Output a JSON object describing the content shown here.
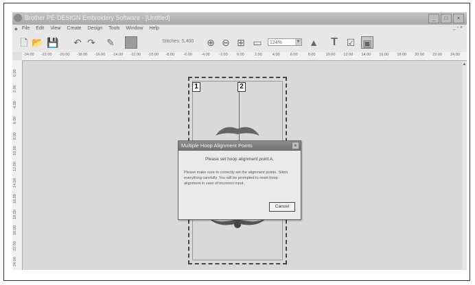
{
  "window": {
    "title": "Brother PE-DESIGN Embroidery Software - [Untitled]",
    "controls": [
      "_",
      "□",
      "×"
    ]
  },
  "menubar": {
    "items": [
      "File",
      "Edit",
      "View",
      "Create",
      "Design",
      "Tools",
      "Window",
      "Help"
    ],
    "mdi_controls": "_ ▫ ×"
  },
  "toolbar": {
    "stitch_label": "Stitches: 5,400",
    "zoom_value": "124%",
    "text_tool_glyph": "T"
  },
  "ruler": {
    "horizontal": [
      "-24.00",
      "-22.00",
      "-20.00",
      "-18.00",
      "-16.00",
      "-14.00",
      "-12.00",
      "-10.00",
      "-8.00",
      "-6.00",
      "-4.00",
      "-2.00",
      "0.00",
      "2.00",
      "4.00",
      "6.00",
      "8.00",
      "10.00",
      "12.00",
      "14.00",
      "16.00",
      "18.00",
      "20.00",
      "22.00",
      "24.00"
    ],
    "vertical": [
      "0.00",
      "2.00",
      "4.00",
      "6.00",
      "8.00",
      "10.00",
      "12.00",
      "14.00",
      "16.00",
      "18.00",
      "20.00",
      "22.00",
      "24.00"
    ]
  },
  "canvas": {
    "marks": [
      "1",
      "2"
    ]
  },
  "dialog": {
    "title": "Multiple Hoop Alignment Points",
    "heading": "Please set hoop alignment point A.",
    "body": "Please make sure to correctly set the alignment points. Stitch everything carefully. You will be prompted to reset hoop alignment in case of incorrect input.",
    "cancel_label": "Cancel"
  },
  "colors": {
    "titlebar": "#b0b0b0",
    "canvas": "#d9d9d9",
    "dialog_title": "#7a7a7a"
  }
}
